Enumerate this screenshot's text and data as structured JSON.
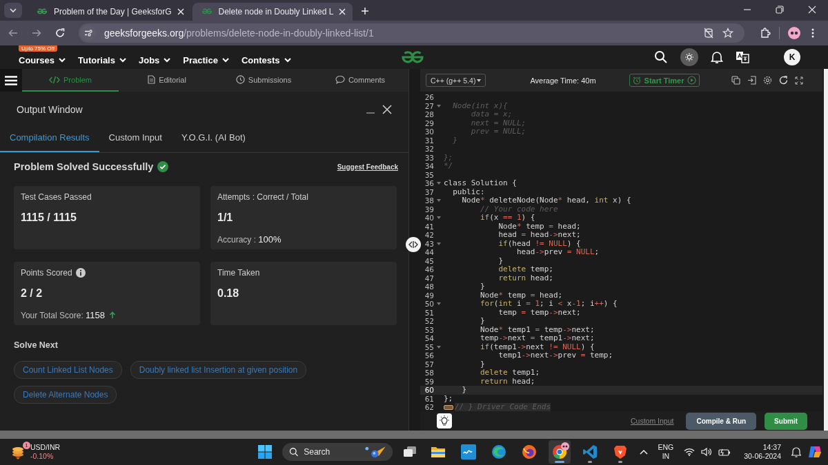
{
  "browser": {
    "tabs": [
      {
        "title": "Problem of the Day | GeeksforG",
        "selected": false
      },
      {
        "title": "Delete node in Doubly Linked L",
        "selected": true
      }
    ],
    "address": {
      "host": "geeksforgeeks.org",
      "path": "/problems/delete-node-in-doubly-linked-list/1"
    }
  },
  "site_nav": {
    "promo_badge": "Upto 75% Off",
    "items": [
      "Courses",
      "Tutorials",
      "Jobs",
      "Practice",
      "Contests"
    ],
    "avatar_letter": "K"
  },
  "problem_tabs": [
    {
      "label": "Problem",
      "selected": true
    },
    {
      "label": "Editorial",
      "selected": false
    },
    {
      "label": "Submissions",
      "selected": false
    },
    {
      "label": "Comments",
      "selected": false
    }
  ],
  "output_window": {
    "title": "Output Window",
    "tabs": [
      {
        "label": "Compilation Results",
        "selected": true
      },
      {
        "label": "Custom Input",
        "selected": false
      },
      {
        "label": "Y.O.G.I. (AI Bot)",
        "selected": false
      }
    ],
    "status": "Problem Solved Successfully",
    "feedback_link": "Suggest Feedback",
    "stats": [
      {
        "label": "Test Cases Passed",
        "value": "1115 / 1115",
        "info": false,
        "rising": false
      },
      {
        "label": "Attempts : Correct / Total",
        "value": "1/1",
        "note": "Accuracy : **100%**",
        "info": false,
        "rising": false
      },
      {
        "label": "Points Scored",
        "value": "2 / 2",
        "note": "Your Total Score: **1158**",
        "info": true,
        "rising": true
      },
      {
        "label": "Time Taken",
        "value": "0.18",
        "info": false,
        "rising": false
      }
    ],
    "solve_next": {
      "title": "Solve Next",
      "problems": [
        "Count Linked List Nodes",
        "Doubly linked list Insertion at given position",
        "Delete Alternate Nodes"
      ]
    }
  },
  "editor": {
    "language": "C++ (g++ 5.4)",
    "average_time": "Average Time: 40m",
    "timer_button": "Start Timer",
    "lines": [
      {
        "number": "26",
        "fold": false,
        "current": false,
        "collapsed": false
      },
      {
        "number": "27",
        "fold": true,
        "current": false,
        "collapsed": false,
        "segments": [
          {
            "text": "  Node(int x){",
            "kind": "comment"
          }
        ]
      },
      {
        "number": "28",
        "fold": false,
        "current": false,
        "collapsed": false,
        "segments": [
          {
            "text": "      data = x;",
            "kind": "comment"
          }
        ]
      },
      {
        "number": "29",
        "fold": false,
        "current": false,
        "collapsed": false,
        "segments": [
          {
            "text": "      next = NULL;",
            "kind": "comment"
          }
        ]
      },
      {
        "number": "30",
        "fold": false,
        "current": false,
        "collapsed": false,
        "segments": [
          {
            "text": "      prev = NULL;",
            "kind": "comment"
          }
        ]
      },
      {
        "number": "31",
        "fold": false,
        "current": false,
        "collapsed": false,
        "segments": [
          {
            "text": "  }",
            "kind": "comment"
          }
        ]
      },
      {
        "number": "32",
        "fold": false,
        "current": false,
        "collapsed": false
      },
      {
        "number": "33",
        "fold": false,
        "current": false,
        "collapsed": false,
        "segments": [
          {
            "text": "};",
            "kind": "comment"
          }
        ]
      },
      {
        "number": "34",
        "fold": false,
        "current": false,
        "collapsed": false,
        "segments": [
          {
            "text": "*/",
            "kind": "comment"
          }
        ]
      },
      {
        "number": "35",
        "fold": false,
        "current": false,
        "collapsed": false
      },
      {
        "number": "36",
        "fold": true,
        "current": false,
        "collapsed": false,
        "segments": [
          {
            "text": "class Solution {",
            "kind": "plain"
          }
        ]
      },
      {
        "number": "37",
        "fold": false,
        "current": false,
        "collapsed": false,
        "segments": [
          {
            "text": "  public:",
            "kind": "plain"
          }
        ]
      },
      {
        "number": "38",
        "fold": true,
        "current": false,
        "collapsed": false,
        "segments": [
          {
            "text": "    Node",
            "kind": "plain"
          },
          {
            "text": "*",
            "kind": "operator"
          },
          {
            "text": " deleteNode(Node",
            "kind": "plain"
          },
          {
            "text": "*",
            "kind": "operator"
          },
          {
            "text": " head, ",
            "kind": "plain"
          },
          {
            "text": "int",
            "kind": "keyword"
          },
          {
            "text": " x) {",
            "kind": "plain"
          }
        ]
      },
      {
        "number": "39",
        "fold": false,
        "current": false,
        "collapsed": false,
        "segments": [
          {
            "text": "        // Your code here",
            "kind": "comment"
          }
        ]
      },
      {
        "number": "40",
        "fold": true,
        "current": false,
        "collapsed": false,
        "segments": [
          {
            "text": "        if",
            "kind": "keyword"
          },
          {
            "text": "(x ",
            "kind": "plain"
          },
          {
            "text": "== 1",
            "kind": "operator"
          },
          {
            "text": ") {",
            "kind": "plain"
          }
        ]
      },
      {
        "number": "41",
        "fold": false,
        "current": false,
        "collapsed": false,
        "segments": [
          {
            "text": "            Node",
            "kind": "plain"
          },
          {
            "text": "*",
            "kind": "operator"
          },
          {
            "text": " temp ",
            "kind": "plain"
          },
          {
            "text": "=",
            "kind": "operator"
          },
          {
            "text": " head;",
            "kind": "plain"
          }
        ]
      },
      {
        "number": "42",
        "fold": false,
        "current": false,
        "collapsed": false,
        "segments": [
          {
            "text": "            head ",
            "kind": "plain"
          },
          {
            "text": "=",
            "kind": "operator"
          },
          {
            "text": " head",
            "kind": "plain"
          },
          {
            "text": "->",
            "kind": "operator"
          },
          {
            "text": "next;",
            "kind": "plain"
          }
        ]
      },
      {
        "number": "43",
        "fold": true,
        "current": false,
        "collapsed": false,
        "segments": [
          {
            "text": "            if",
            "kind": "keyword"
          },
          {
            "text": "(head ",
            "kind": "plain"
          },
          {
            "text": "!= NULL",
            "kind": "operator"
          },
          {
            "text": ") {",
            "kind": "plain"
          }
        ]
      },
      {
        "number": "44",
        "fold": false,
        "current": false,
        "collapsed": false,
        "segments": [
          {
            "text": "                head",
            "kind": "plain"
          },
          {
            "text": "->",
            "kind": "operator"
          },
          {
            "text": "prev ",
            "kind": "plain"
          },
          {
            "text": "= NULL",
            "kind": "operator"
          },
          {
            "text": ";",
            "kind": "plain"
          }
        ]
      },
      {
        "number": "45",
        "fold": false,
        "current": false,
        "collapsed": false,
        "segments": [
          {
            "text": "            }",
            "kind": "plain"
          }
        ]
      },
      {
        "number": "46",
        "fold": false,
        "current": false,
        "collapsed": false,
        "segments": [
          {
            "text": "            delete",
            "kind": "keyword"
          },
          {
            "text": " temp;",
            "kind": "plain"
          }
        ]
      },
      {
        "number": "47",
        "fold": false,
        "current": false,
        "collapsed": false,
        "segments": [
          {
            "text": "            return",
            "kind": "keyword"
          },
          {
            "text": " head;",
            "kind": "plain"
          }
        ]
      },
      {
        "number": "48",
        "fold": false,
        "current": false,
        "collapsed": false,
        "segments": [
          {
            "text": "        }",
            "kind": "plain"
          }
        ]
      },
      {
        "number": "49",
        "fold": false,
        "current": false,
        "collapsed": false,
        "segments": [
          {
            "text": "        Node",
            "kind": "plain"
          },
          {
            "text": "*",
            "kind": "operator"
          },
          {
            "text": " temp ",
            "kind": "plain"
          },
          {
            "text": "=",
            "kind": "operator"
          },
          {
            "text": " head;",
            "kind": "plain"
          }
        ]
      },
      {
        "number": "50",
        "fold": true,
        "current": false,
        "collapsed": false,
        "segments": [
          {
            "text": "        for",
            "kind": "keyword"
          },
          {
            "text": "(",
            "kind": "plain"
          },
          {
            "text": "int",
            "kind": "keyword"
          },
          {
            "text": " i ",
            "kind": "plain"
          },
          {
            "text": "= 1",
            "kind": "operator"
          },
          {
            "text": "; i ",
            "kind": "plain"
          },
          {
            "text": "<",
            "kind": "operator"
          },
          {
            "text": " x",
            "kind": "plain"
          },
          {
            "text": "-1",
            "kind": "operator"
          },
          {
            "text": "; i",
            "kind": "plain"
          },
          {
            "text": "++",
            "kind": "operator"
          },
          {
            "text": ") {",
            "kind": "plain"
          }
        ]
      },
      {
        "number": "51",
        "fold": false,
        "current": false,
        "collapsed": false,
        "segments": [
          {
            "text": "            temp ",
            "kind": "plain"
          },
          {
            "text": "=",
            "kind": "operator"
          },
          {
            "text": " temp",
            "kind": "plain"
          },
          {
            "text": "->",
            "kind": "operator"
          },
          {
            "text": "next;",
            "kind": "plain"
          }
        ]
      },
      {
        "number": "52",
        "fold": false,
        "current": false,
        "collapsed": false,
        "segments": [
          {
            "text": "        }",
            "kind": "plain"
          }
        ]
      },
      {
        "number": "53",
        "fold": false,
        "current": false,
        "collapsed": false,
        "segments": [
          {
            "text": "        Node",
            "kind": "plain"
          },
          {
            "text": "*",
            "kind": "operator"
          },
          {
            "text": " temp1 ",
            "kind": "plain"
          },
          {
            "text": "=",
            "kind": "operator"
          },
          {
            "text": " temp",
            "kind": "plain"
          },
          {
            "text": "->",
            "kind": "operator"
          },
          {
            "text": "next;",
            "kind": "plain"
          }
        ]
      },
      {
        "number": "54",
        "fold": false,
        "current": false,
        "collapsed": false,
        "segments": [
          {
            "text": "        temp",
            "kind": "plain"
          },
          {
            "text": "->",
            "kind": "operator"
          },
          {
            "text": "next ",
            "kind": "plain"
          },
          {
            "text": "=",
            "kind": "operator"
          },
          {
            "text": " temp1",
            "kind": "plain"
          },
          {
            "text": "->",
            "kind": "operator"
          },
          {
            "text": "next;",
            "kind": "plain"
          }
        ]
      },
      {
        "number": "55",
        "fold": true,
        "current": false,
        "collapsed": false,
        "segments": [
          {
            "text": "        if",
            "kind": "keyword"
          },
          {
            "text": "(temp1",
            "kind": "plain"
          },
          {
            "text": "->",
            "kind": "operator"
          },
          {
            "text": "next ",
            "kind": "plain"
          },
          {
            "text": "!= NULL",
            "kind": "operator"
          },
          {
            "text": ") {",
            "kind": "plain"
          }
        ]
      },
      {
        "number": "56",
        "fold": false,
        "current": false,
        "collapsed": false,
        "segments": [
          {
            "text": "            temp1",
            "kind": "plain"
          },
          {
            "text": "->",
            "kind": "operator"
          },
          {
            "text": "next",
            "kind": "plain"
          },
          {
            "text": "->",
            "kind": "operator"
          },
          {
            "text": "prev ",
            "kind": "plain"
          },
          {
            "text": "=",
            "kind": "operator"
          },
          {
            "text": " temp;",
            "kind": "plain"
          }
        ]
      },
      {
        "number": "57",
        "fold": false,
        "current": false,
        "collapsed": false,
        "segments": [
          {
            "text": "        }",
            "kind": "plain"
          }
        ]
      },
      {
        "number": "58",
        "fold": false,
        "current": false,
        "collapsed": false,
        "segments": [
          {
            "text": "        delete",
            "kind": "keyword"
          },
          {
            "text": " temp1;",
            "kind": "plain"
          }
        ]
      },
      {
        "number": "59",
        "fold": false,
        "current": false,
        "collapsed": false,
        "segments": [
          {
            "text": "        return",
            "kind": "keyword"
          },
          {
            "text": " head;",
            "kind": "plain"
          }
        ]
      },
      {
        "number": "60",
        "fold": false,
        "current": true,
        "collapsed": false,
        "segments": [
          {
            "text": "    }",
            "kind": "plain"
          }
        ]
      },
      {
        "number": "61",
        "fold": false,
        "current": false,
        "collapsed": false,
        "segments": [
          {
            "text": "};",
            "kind": "plain"
          }
        ]
      },
      {
        "number": "62",
        "fold": false,
        "current": false,
        "collapsed": true,
        "segments": [
          {
            "text": "// } Driver Code Ends",
            "kind": "comment"
          }
        ]
      }
    ],
    "custom_input": "Custom Input",
    "compile_button": "Compile & Run",
    "submit_button": "Submit"
  },
  "taskbar": {
    "widget": {
      "badge": "1",
      "title": "USD/INR",
      "change": "-0.10%"
    },
    "search_placeholder": "Search",
    "apps": [
      {
        "kind": "files",
        "running": false,
        "selected": false
      },
      {
        "kind": "tile",
        "running": false,
        "selected": false
      },
      {
        "kind": "edge",
        "running": false,
        "selected": false
      },
      {
        "kind": "firefox",
        "running": false,
        "selected": false
      },
      {
        "kind": "chrome",
        "running": true,
        "selected": true
      },
      {
        "kind": "vscode",
        "running": true,
        "selected": false
      },
      {
        "kind": "brave",
        "running": true,
        "selected": false
      }
    ],
    "language": "ENG",
    "region": "IN",
    "time": "14:37",
    "date": "30-06-2024"
  }
}
